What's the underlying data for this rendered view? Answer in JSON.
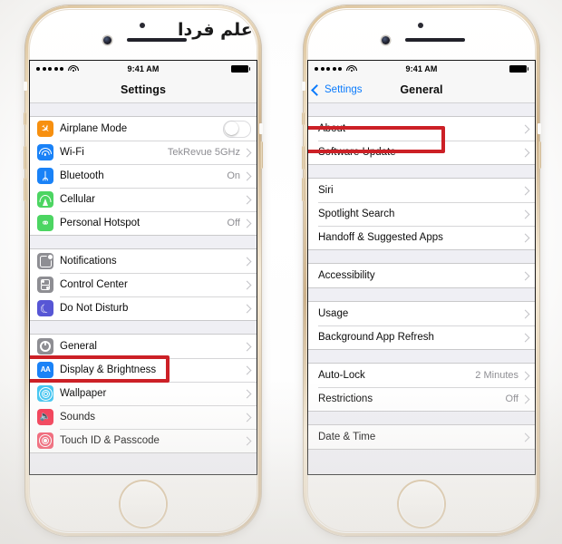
{
  "watermark": {
    "text": "علم فردا"
  },
  "phones": [
    {
      "id": "left",
      "statusbar": {
        "signal_dots": 5,
        "wifi_icon": "wifi-icon",
        "time": "9:41 AM",
        "battery_icon": "battery-full-icon"
      },
      "navbar": {
        "title": "Settings",
        "back_label": null
      },
      "highlighted_row": "General",
      "sections": [
        {
          "rows": [
            {
              "label": "Airplane Mode",
              "icon": "airplane-icon",
              "icon_color": "#f79010",
              "accessory": "toggle",
              "toggle_on": false
            },
            {
              "label": "Wi-Fi",
              "icon": "wifi-icon",
              "icon_color": "#1a82f7",
              "accessory": "chevron",
              "value": "TekRevue 5GHz"
            },
            {
              "label": "Bluetooth",
              "icon": "bluetooth-icon",
              "icon_color": "#1a82f7",
              "accessory": "chevron",
              "value": "On"
            },
            {
              "label": "Cellular",
              "icon": "cellular-icon",
              "icon_color": "#4cd562",
              "accessory": "chevron",
              "value": ""
            },
            {
              "label": "Personal Hotspot",
              "icon": "hotspot-icon",
              "icon_color": "#4cd562",
              "accessory": "chevron",
              "value": "Off"
            }
          ]
        },
        {
          "rows": [
            {
              "label": "Notifications",
              "icon": "notifications-icon",
              "icon_color": "#8e8e93",
              "accessory": "chevron",
              "value": ""
            },
            {
              "label": "Control Center",
              "icon": "control-center-icon",
              "icon_color": "#8e8e93",
              "accessory": "chevron",
              "value": ""
            },
            {
              "label": "Do Not Disturb",
              "icon": "do-not-disturb-icon",
              "icon_color": "#5756d5",
              "accessory": "chevron",
              "value": ""
            }
          ]
        },
        {
          "rows": [
            {
              "label": "General",
              "icon": "general-gear-icon",
              "icon_color": "#8e8e93",
              "accessory": "chevron",
              "value": ""
            },
            {
              "label": "Display & Brightness",
              "icon": "display-brightness-icon",
              "icon_color": "#1a82f7",
              "accessory": "chevron",
              "value": ""
            },
            {
              "label": "Wallpaper",
              "icon": "wallpaper-icon",
              "icon_color": "#42c6f2",
              "accessory": "chevron",
              "value": ""
            },
            {
              "label": "Sounds",
              "icon": "sounds-icon",
              "icon_color": "#f4344e",
              "accessory": "chevron",
              "value": ""
            },
            {
              "label": "Touch ID & Passcode",
              "icon": "touch-id-icon",
              "icon_color": "#f4556a",
              "accessory": "chevron",
              "value": ""
            }
          ]
        }
      ]
    },
    {
      "id": "right",
      "statusbar": {
        "signal_dots": 5,
        "wifi_icon": "wifi-icon",
        "time": "9:41 AM",
        "battery_icon": "battery-full-icon"
      },
      "navbar": {
        "title": "General",
        "back_label": "Settings"
      },
      "highlighted_row": "About",
      "sections": [
        {
          "rows": [
            {
              "label": "About",
              "accessory": "chevron",
              "value": ""
            },
            {
              "label": "Software Update",
              "accessory": "chevron",
              "value": ""
            }
          ]
        },
        {
          "rows": [
            {
              "label": "Siri",
              "accessory": "chevron",
              "value": ""
            },
            {
              "label": "Spotlight Search",
              "accessory": "chevron",
              "value": ""
            },
            {
              "label": "Handoff & Suggested Apps",
              "accessory": "chevron",
              "value": ""
            }
          ]
        },
        {
          "rows": [
            {
              "label": "Accessibility",
              "accessory": "chevron",
              "value": ""
            }
          ]
        },
        {
          "rows": [
            {
              "label": "Usage",
              "accessory": "chevron",
              "value": ""
            },
            {
              "label": "Background App Refresh",
              "accessory": "chevron",
              "value": ""
            }
          ]
        },
        {
          "rows": [
            {
              "label": "Auto-Lock",
              "accessory": "chevron",
              "value": "2 Minutes"
            },
            {
              "label": "Restrictions",
              "accessory": "chevron",
              "value": "Off"
            }
          ]
        },
        {
          "rows": [
            {
              "label": "Date & Time",
              "accessory": "chevron",
              "value": ""
            }
          ]
        }
      ]
    }
  ],
  "colors": {
    "highlight_box": "#cc2026",
    "ios_blue": "#0b7bfc",
    "list_background": "#efeff4",
    "separator": "#d6d6d8",
    "secondary_text": "#8e8e93"
  }
}
